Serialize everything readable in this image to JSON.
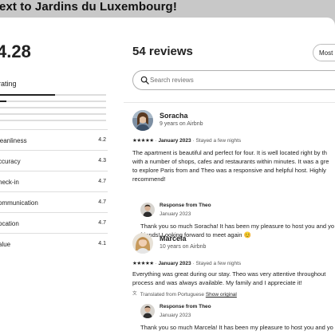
{
  "listing_title_fragment": "ext to Jardins du Luxembourg!",
  "rating": {
    "overall": "4.28",
    "section_label": "rating",
    "distribution": [
      0.52,
      0.06,
      0,
      0,
      0
    ],
    "categories": [
      {
        "label": "leanliness",
        "value": "4.2"
      },
      {
        "label": "ccuracy",
        "value": "4.3"
      },
      {
        "label": "heck-in",
        "value": "4.7"
      },
      {
        "label": "ommunication",
        "value": "4.7"
      },
      {
        "label": "ocation",
        "value": "4.7"
      },
      {
        "label": "alue",
        "value": "4.1"
      }
    ]
  },
  "reviews_panel": {
    "heading": "54 reviews",
    "sort_label": "Most re",
    "search_placeholder": "Search reviews",
    "reviews": [
      {
        "name": "Soracha",
        "tenure": "9 years on Airbnb",
        "stars": "★★★★★",
        "date": "January 2023",
        "separator": "·",
        "stay": "Stayed a few nights",
        "body": [
          "The apartment is beautiful and perfect for four. It is well located right by th",
          "with a number of shops, cafes and restaurants within minutes. It was a gre",
          "to explore Paris from and Theo was a responsive and helpful host. Highly",
          "recommend!"
        ],
        "response": {
          "title": "Response from Theo",
          "date": "January 2023",
          "body": [
            "Thank you so much Soracha! It has been my pleasure to host you and yo",
            "friends! Looking forward to meet again 😊"
          ]
        }
      },
      {
        "name": "Marcela",
        "tenure": "10 years on Airbnb",
        "stars": "★★★★★",
        "date": "January 2023",
        "separator": "·",
        "stay": "Stayed a few nights",
        "body": [
          "Everything was great during our stay. Theo was very attentive throughout",
          "process and was always available. My family and I appreciate it!"
        ],
        "translated_note": "Translated from Portuguese",
        "show_original": "Show original",
        "response": {
          "title": "Response from Theo",
          "date": "January 2023",
          "body": [
            "Thank you so much Marcela! It has been my pleasure to host you and yo"
          ]
        }
      }
    ]
  }
}
